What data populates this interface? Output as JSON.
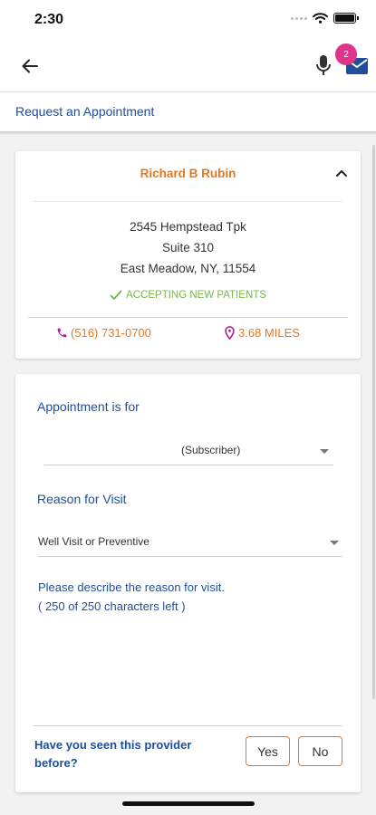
{
  "status": {
    "time": "2:30"
  },
  "nav": {
    "badge_count": "2",
    "back_icon": "arrow-left-icon",
    "mic_icon": "microphone-icon",
    "mail_icon": "mail-icon"
  },
  "page": {
    "title": "Request an Appointment"
  },
  "provider": {
    "name": "Richard B Rubin",
    "address_line1": "2545 Hempstead Tpk",
    "address_line2": "Suite 310",
    "address_line3": "East Meadow, NY, 11554",
    "accepting": "ACCEPTING NEW PATIENTS",
    "phone": "(516) 731-0700",
    "distance": "3.68 MILES"
  },
  "form": {
    "appointment_for_label": "Appointment is for",
    "appointment_for_value": "(Subscriber)",
    "reason_label": "Reason for Visit",
    "reason_value": "Well Visit or Preventive",
    "description_placeholder": "Please describe the reason for visit.",
    "char_count": "( 250 of 250 characters left )",
    "seen_question": "Have you seen this provider before?",
    "yes_label": "Yes",
    "no_label": "No"
  },
  "colors": {
    "accent_orange": "#e8781f",
    "brand_blue": "#1f4e9a",
    "success_green": "#7ab648",
    "badge_pink": "#e0348b",
    "icon_purple": "#b5179e"
  }
}
